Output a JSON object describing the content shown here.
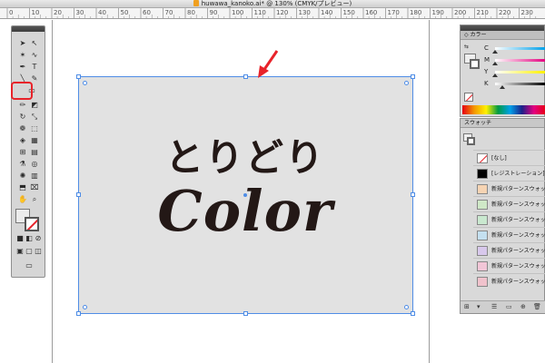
{
  "window": {
    "title": "huwawa_kanoko.ai* @ 130% (CMYK/プレビュー)"
  },
  "ruler": {
    "ticks": [
      "0",
      "10",
      "20",
      "30",
      "40",
      "50",
      "60",
      "70",
      "80",
      "90",
      "100",
      "110",
      "120",
      "130",
      "140",
      "150",
      "160",
      "170",
      "180",
      "190",
      "200",
      "210",
      "220",
      "230"
    ]
  },
  "artwork": {
    "line1": "とりどり",
    "line2": "Color"
  },
  "color_panel": {
    "title": "カラー",
    "channels": [
      {
        "label": "C",
        "level": 0
      },
      {
        "label": "M",
        "level": 0
      },
      {
        "label": "Y",
        "level": 0
      },
      {
        "label": "K",
        "level": 0.15
      }
    ]
  },
  "swatch_panel": {
    "title": "スウォッチ",
    "items": [
      {
        "label": "[なし]",
        "color": "#ffffff"
      },
      {
        "label": "[レジストレーション]",
        "color": "#000000"
      },
      {
        "label": "新規パターンスウォッチ",
        "color": "#f6d4b3"
      },
      {
        "label": "新規パターンスウォッチ",
        "color": "#cfe8c7"
      },
      {
        "label": "新規パターンスウォッチ",
        "color": "#c9e8cf"
      },
      {
        "label": "新規パターンスウォッチ",
        "color": "#c4e0f0"
      },
      {
        "label": "新規パターンスウォッチ",
        "color": "#d8c8ec"
      },
      {
        "label": "新規パターンスウォッチ",
        "color": "#f2c6d7"
      },
      {
        "label": "新規パターンスウォッチ",
        "color": "#f0c2cc"
      }
    ]
  },
  "colors": {
    "selection": "#4f8de6",
    "highlight": "#e8232a",
    "ink": "#231816"
  },
  "icons": {
    "tool_highlight": "rectangle-tool-icon",
    "pointer": "red-arrow-icon"
  }
}
